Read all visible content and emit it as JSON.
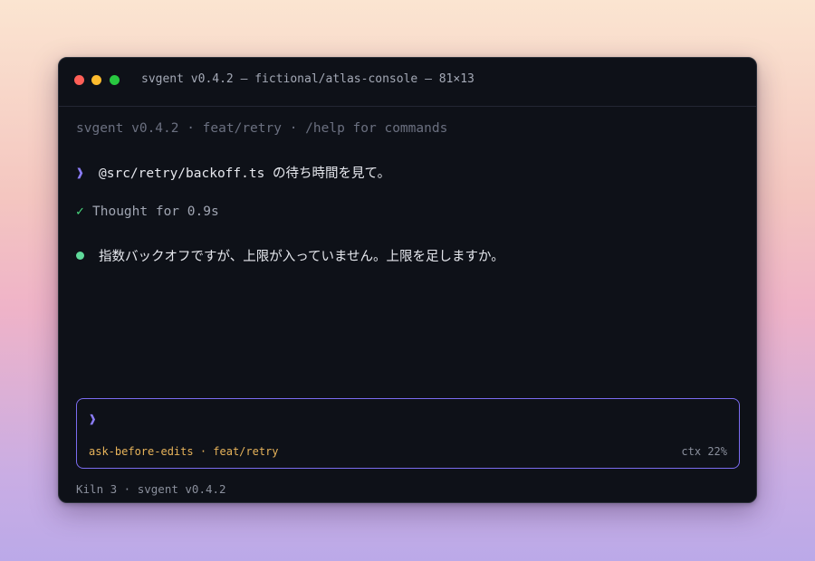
{
  "window": {
    "title": "svgent v0.4.2 — fictional/atlas-console — 81×13",
    "traffic_lights": {
      "close_color": "#ff5f57",
      "minimize_color": "#febc2e",
      "zoom_color": "#28c840"
    }
  },
  "terminal": {
    "banner": "svgent v0.4.2 · feat/retry · /help for commands",
    "user_message": {
      "prompt_glyph": "❱",
      "text": "@src/retry/backoff.ts の待ち時間を見て。"
    },
    "thought": {
      "icon": "check-icon",
      "glyph": "✓",
      "text": "Thought for 0.9s"
    },
    "assistant_message": {
      "icon": "bullet-icon",
      "text": "指数バックオフですが、上限が入っていません。上限を足しますか。"
    }
  },
  "input": {
    "prompt_glyph": "❱",
    "mode": "ask-before-edits · feat/retry",
    "context_usage": "ctx 22%"
  },
  "footer": {
    "text": "Kiln 3 · svgent v0.4.2"
  },
  "colors": {
    "accent": "#8b7cf6",
    "success": "#4ade80",
    "mode": "#e7b35a",
    "background": "#0e1118"
  }
}
